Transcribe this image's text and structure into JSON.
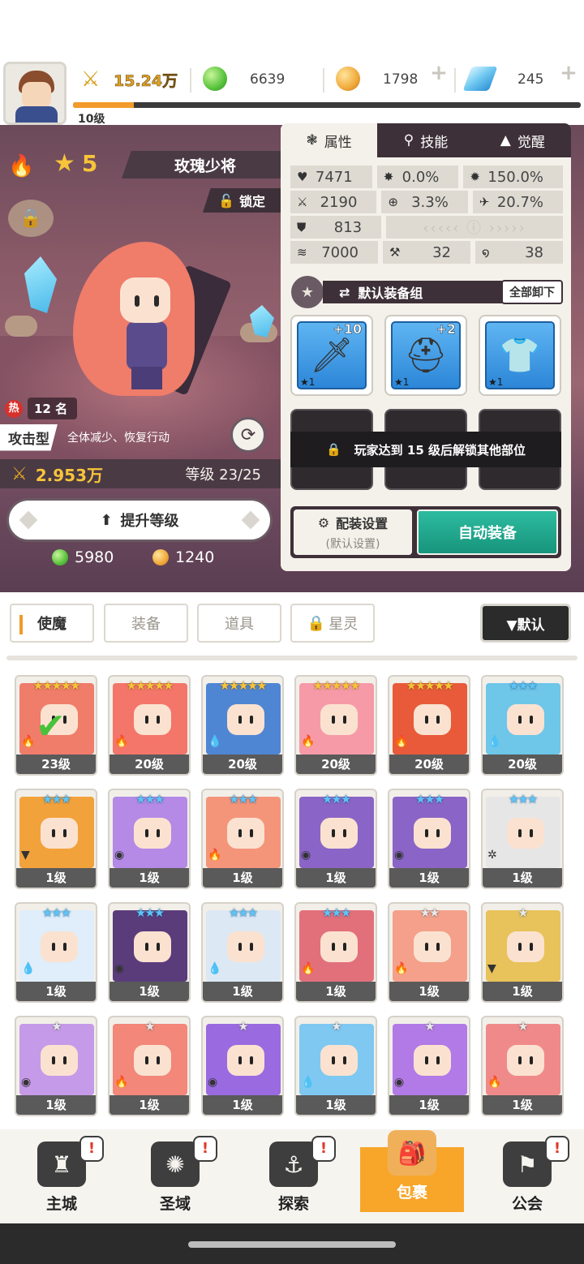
{
  "header": {
    "power": "15.24万",
    "green_gem": "6639",
    "gold_coin": "1798",
    "blue_crystal": "245",
    "player_level": "10级",
    "xp_progress": 0.12
  },
  "hero": {
    "element": "fire",
    "star": "5",
    "name": "玫瑰少将",
    "lock_label": "锁定",
    "rank_hot": "热",
    "rank": "12 名",
    "type": "攻击型",
    "type_desc": "全体减少、恢复行动",
    "power": "2.953万",
    "level_text": "等级 23/25",
    "upgrade_label": "提升等级",
    "cost_green": "5980",
    "cost_gold": "1240"
  },
  "info": {
    "tabs": [
      {
        "label": "属性",
        "icon": "attribute-icon"
      },
      {
        "label": "技能",
        "icon": "skill-icon"
      },
      {
        "label": "觉醒",
        "icon": "awaken-icon"
      }
    ],
    "stats": {
      "hp": "7471",
      "crit": "0.0%",
      "crit_dmg": "150.0%",
      "atk": "2190",
      "hit": "3.3%",
      "dodge": "20.7%",
      "def": "813",
      "speed": "7000",
      "pierce": "32",
      "resist": "38"
    },
    "equip_set_name": "默认装备组",
    "unequip_all": "全部卸下",
    "slots": [
      {
        "plus": "+10",
        "rarity": "★1",
        "icon": "sword-icon"
      },
      {
        "plus": "+2",
        "rarity": "★1",
        "icon": "helmet-icon"
      },
      {
        "plus": "",
        "rarity": "★1",
        "icon": "armor-icon"
      }
    ],
    "lock_message": "玩家达到 15 级后解锁其他部位",
    "config_label": "配装设置",
    "config_sub": "(默认设置)",
    "auto_equip": "自动装备"
  },
  "inventory": {
    "tabs": [
      "使魔",
      "装备",
      "道具",
      "星灵"
    ],
    "sort_label": "▼默认"
  },
  "heroes": [
    {
      "stars": "★★★★★",
      "tier": "gold",
      "level": "23级",
      "el": "fire",
      "color": "#f07c6a",
      "selected": true
    },
    {
      "stars": "★★★★★",
      "tier": "gold",
      "level": "20级",
      "el": "fire",
      "color": "#f4756a",
      "selected": false
    },
    {
      "stars": "★★★★★",
      "tier": "gold",
      "level": "20级",
      "el": "water",
      "color": "#4f86d4",
      "selected": false
    },
    {
      "stars": "★★★★★",
      "tier": "gold",
      "level": "20级",
      "el": "fire",
      "color": "#f69aa8",
      "selected": false
    },
    {
      "stars": "★★★★★",
      "tier": "gold",
      "level": "20级",
      "el": "fire",
      "color": "#e85a3a",
      "selected": false
    },
    {
      "stars": "★★★",
      "tier": "blue",
      "level": "20级",
      "el": "water",
      "color": "#6ec6e9",
      "selected": false
    },
    {
      "stars": "★★★",
      "tier": "blue",
      "level": "1级",
      "el": "earth",
      "color": "#f2a23a",
      "selected": false
    },
    {
      "stars": "★★★",
      "tier": "blue",
      "level": "1级",
      "el": "dark",
      "color": "#b48ae6",
      "selected": false
    },
    {
      "stars": "★★★",
      "tier": "blue",
      "level": "1级",
      "el": "fire",
      "color": "#f4957a",
      "selected": false
    },
    {
      "stars": "★★★",
      "tier": "blue",
      "level": "1级",
      "el": "dark",
      "color": "#8a64c6",
      "selected": false
    },
    {
      "stars": "★★★",
      "tier": "blue",
      "level": "1级",
      "el": "dark",
      "color": "#8a64c6",
      "selected": false
    },
    {
      "stars": "★★★",
      "tier": "blue",
      "level": "1级",
      "el": "light",
      "color": "#e6e6e6",
      "selected": false
    },
    {
      "stars": "★★★",
      "tier": "blue",
      "level": "1级",
      "el": "water",
      "color": "#dfeefa",
      "selected": false
    },
    {
      "stars": "★★★",
      "tier": "blue",
      "level": "1级",
      "el": "dark",
      "color": "#5a3c7a",
      "selected": false
    },
    {
      "stars": "★★★",
      "tier": "blue",
      "level": "1级",
      "el": "water",
      "color": "#dce8f4",
      "selected": false
    },
    {
      "stars": "★★★",
      "tier": "blue",
      "level": "1级",
      "el": "fire",
      "color": "#e2707a",
      "selected": false
    },
    {
      "stars": "★★",
      "tier": "silver",
      "level": "1级",
      "el": "fire",
      "color": "#f4a08a",
      "selected": false
    },
    {
      "stars": "★",
      "tier": "silver",
      "level": "1级",
      "el": "earth",
      "color": "#e8c25a",
      "selected": false
    },
    {
      "stars": "★",
      "tier": "silver",
      "level": "1级",
      "el": "dark",
      "color": "#c59ae8",
      "selected": false
    },
    {
      "stars": "★",
      "tier": "silver",
      "level": "1级",
      "el": "fire",
      "color": "#f2877a",
      "selected": false
    },
    {
      "stars": "★",
      "tier": "silver",
      "level": "1级",
      "el": "dark",
      "color": "#9a6ae0",
      "selected": false
    },
    {
      "stars": "★",
      "tier": "silver",
      "level": "1级",
      "el": "water",
      "color": "#7ec8f2",
      "selected": false
    },
    {
      "stars": "★",
      "tier": "silver",
      "level": "1级",
      "el": "dark",
      "color": "#b27ae6",
      "selected": false
    },
    {
      "stars": "★",
      "tier": "silver",
      "level": "1级",
      "el": "fire",
      "color": "#f08a8a",
      "selected": false
    }
  ],
  "nav": [
    {
      "label": "主城",
      "icon": "castle-icon",
      "alert": "!"
    },
    {
      "label": "圣域",
      "icon": "vortex-icon",
      "alert": "!"
    },
    {
      "label": "探索",
      "icon": "explore-icon",
      "alert": "!"
    },
    {
      "label": "包裹",
      "icon": "bag-icon",
      "alert": ""
    },
    {
      "label": "公会",
      "icon": "guild-icon",
      "alert": "!"
    }
  ],
  "colors": {
    "accent_orange": "#f29a2a",
    "auto_equip_green": "#1fa88c",
    "panel_dark": "#3e3038"
  }
}
